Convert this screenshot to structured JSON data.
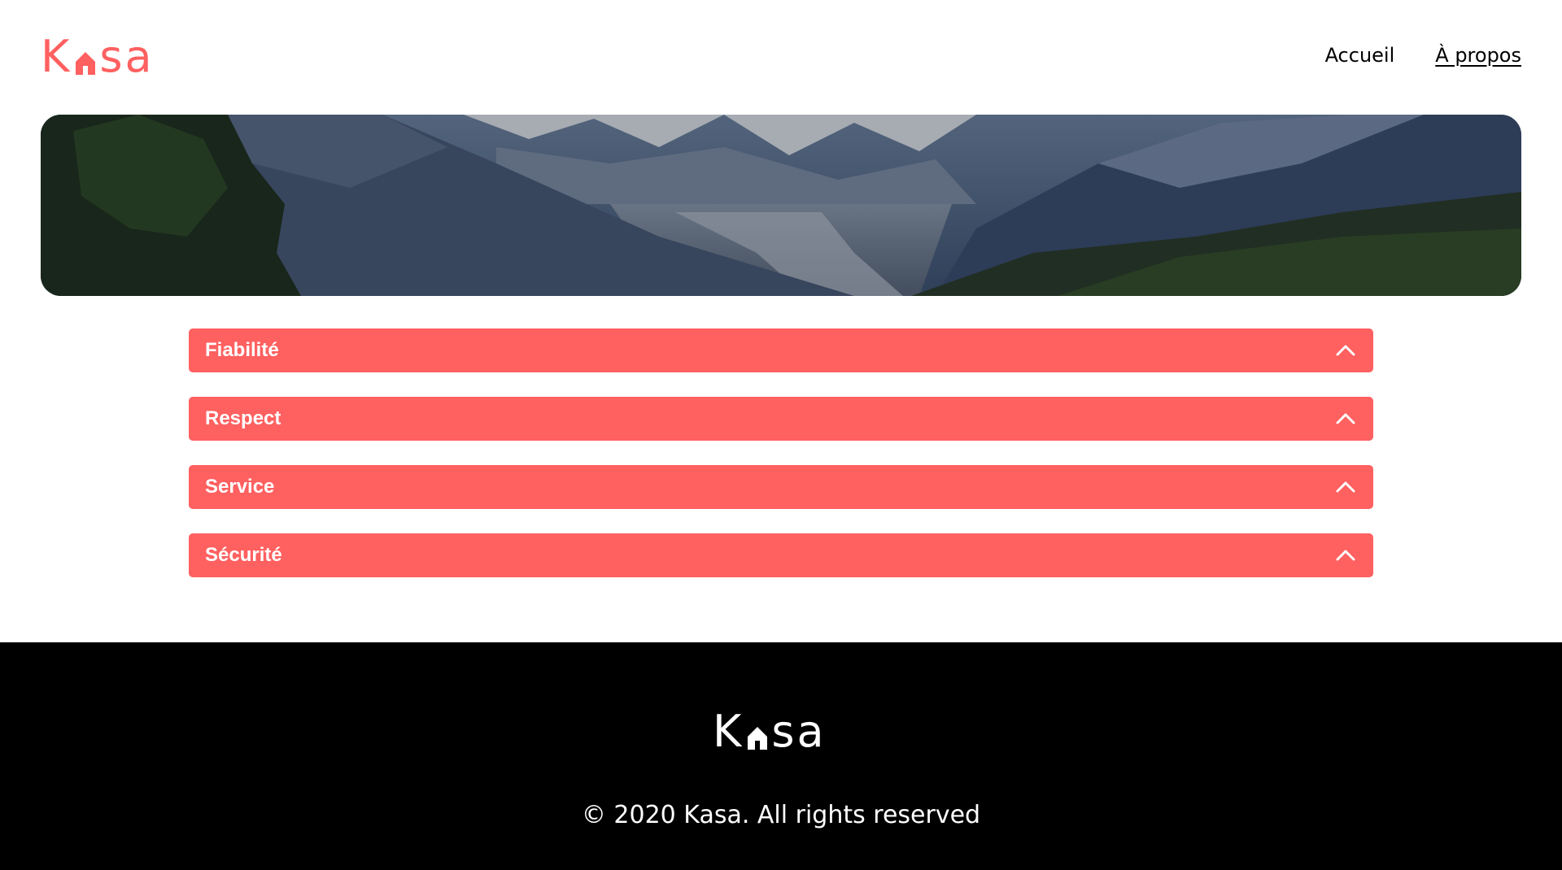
{
  "brand": {
    "name_k": "K",
    "name_sa": "sa",
    "accent_color": "#ff6060",
    "logo_icon": "house-icon"
  },
  "nav": {
    "items": [
      {
        "label": "Accueil",
        "active": false
      },
      {
        "label": "À propos",
        "active": true
      }
    ]
  },
  "banner": {
    "image_subject": "mountain-landscape"
  },
  "accordion": {
    "items": [
      {
        "title": "Fiabilité",
        "icon": "chevron-up-icon"
      },
      {
        "title": "Respect",
        "icon": "chevron-up-icon"
      },
      {
        "title": "Service",
        "icon": "chevron-up-icon"
      },
      {
        "title": "Sécurité",
        "icon": "chevron-up-icon"
      }
    ]
  },
  "footer": {
    "name_k": "K",
    "name_sa": "sa",
    "copyright": "© 2020 Kasa. All rights reserved",
    "background": "#000000"
  }
}
